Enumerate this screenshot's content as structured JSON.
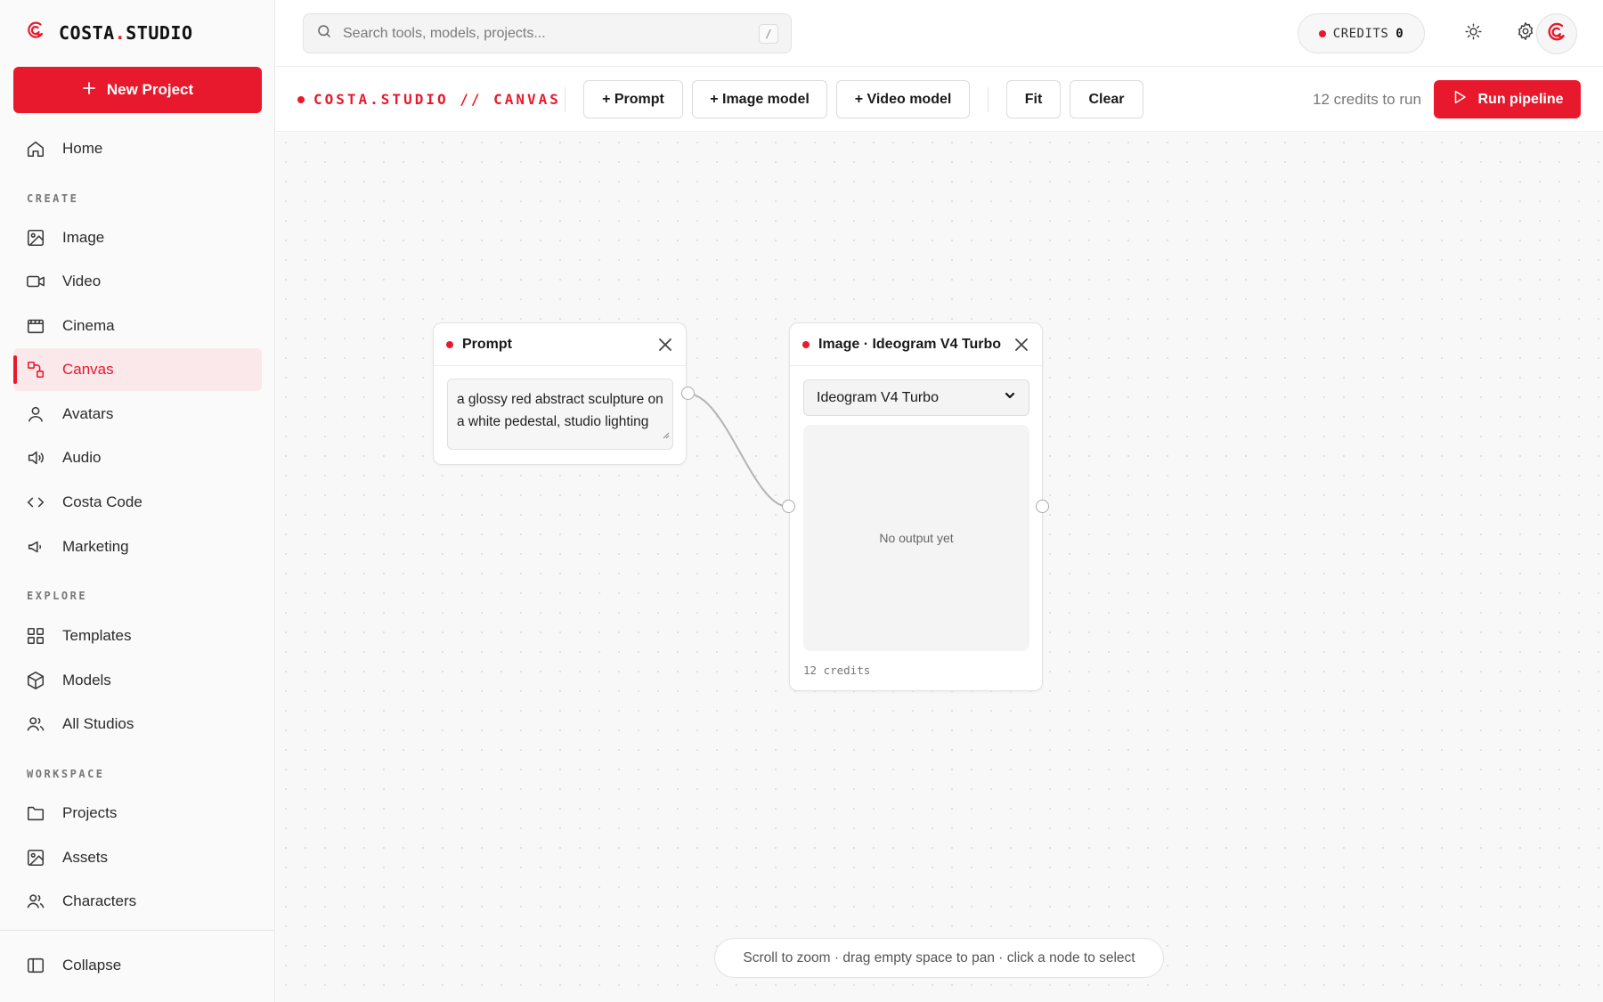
{
  "brand": {
    "name_main": "COSTA",
    "name_sep": ".",
    "name_tail": "STUDIO",
    "accent_color": "#e8192c"
  },
  "sidebar": {
    "new_project_label": "New Project",
    "home": {
      "label": "Home",
      "icon": "home-icon"
    },
    "sections": {
      "create": "CREATE",
      "explore": "EXPLORE",
      "workspace": "WORKSPACE"
    },
    "create_items": [
      {
        "label": "Image",
        "icon": "image-icon"
      },
      {
        "label": "Video",
        "icon": "video-icon"
      },
      {
        "label": "Cinema",
        "icon": "clapperboard-icon"
      },
      {
        "label": "Canvas",
        "icon": "canvas-icon",
        "active": true
      },
      {
        "label": "Avatars",
        "icon": "user-icon"
      },
      {
        "label": "Audio",
        "icon": "speaker-icon"
      },
      {
        "label": "Costa Code",
        "icon": "code-icon"
      },
      {
        "label": "Marketing",
        "icon": "megaphone-icon"
      }
    ],
    "explore_items": [
      {
        "label": "Templates",
        "icon": "grid-icon"
      },
      {
        "label": "Models",
        "icon": "cube-icon"
      },
      {
        "label": "All Studios",
        "icon": "users-icon"
      }
    ],
    "workspace_items": [
      {
        "label": "Projects",
        "icon": "folder-icon"
      },
      {
        "label": "Assets",
        "icon": "image-icon"
      },
      {
        "label": "Characters",
        "icon": "users-icon"
      }
    ],
    "collapse_label": "Collapse"
  },
  "topbar": {
    "search_placeholder": "Search tools, models, projects...",
    "search_shortcut": "/",
    "credits_label": "CREDITS",
    "credits_value": "0"
  },
  "toolbar": {
    "title": "COSTA.STUDIO // CANVAS",
    "add_prompt": "+ Prompt",
    "add_image_model": "+ Image model",
    "add_video_model": "+ Video model",
    "fit": "Fit",
    "clear": "Clear",
    "run_cost": "12 credits to run",
    "run_label": "Run pipeline"
  },
  "canvas": {
    "prompt_node": {
      "title": "Prompt",
      "text": "a glossy red abstract sculpture on a white pedestal, studio lighting"
    },
    "image_node": {
      "title": "Image · Ideogram V4 Turbo",
      "selected_model": "Ideogram V4 Turbo",
      "output_text": "No output yet",
      "credits": "12 credits"
    },
    "hint": "Scroll to zoom · drag empty space to pan · click a node to select"
  }
}
